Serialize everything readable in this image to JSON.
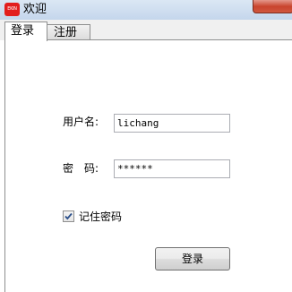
{
  "window": {
    "title": "欢迎",
    "app_icon": "app-logo-icon",
    "app_icon_text": "EKIN"
  },
  "tabs": [
    {
      "label": "登录",
      "selected": true
    },
    {
      "label": "注册",
      "selected": false
    }
  ],
  "form": {
    "username_label": "用户名:",
    "username_value": "lichang",
    "password_label": "密　码:",
    "password_value": "******",
    "remember_label": "记住密码",
    "remember_checked": true,
    "login_button": "登录"
  },
  "colors": {
    "close_button": "#c9442e",
    "app_icon": "#e21e1e"
  }
}
